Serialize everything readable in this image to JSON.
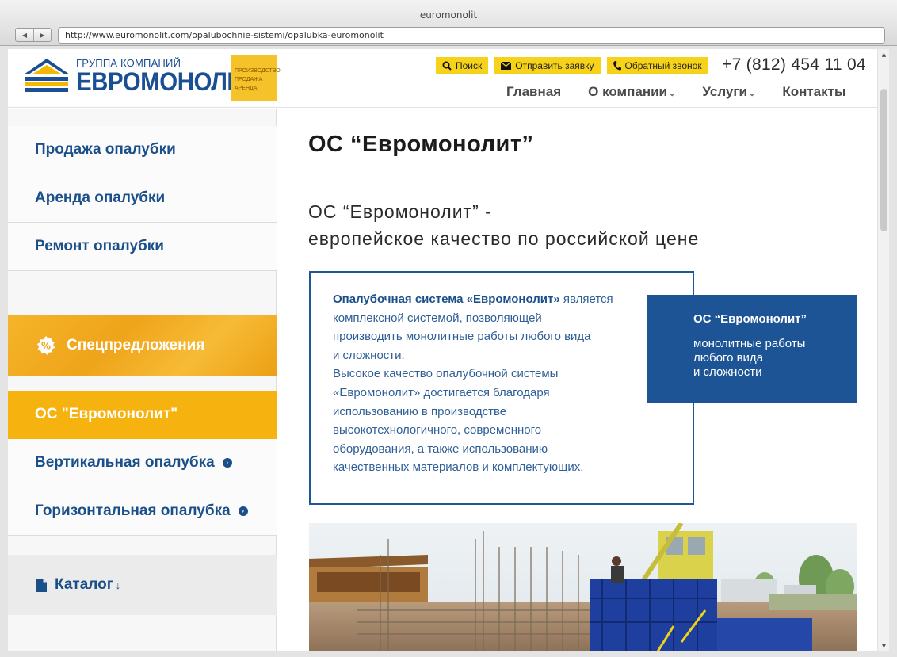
{
  "browser": {
    "window_title": "euromonolit",
    "url": "http://www.euromonolit.com/opalubochnie-sistemi/opalubka-euromonolit",
    "back_icon": "back-arrow-icon",
    "forward_icon": "forward-arrow-icon"
  },
  "header": {
    "logo_group": "ГРУППА КОМПАНИЙ",
    "logo_name": "ЕВРОМОНОЛИТ",
    "logo_badge_lines": [
      "ПРОИЗВОДСТВО",
      "ПРОДАЖА",
      "АРЕНДА"
    ],
    "actions": {
      "search": "Поиск",
      "send_request": "Отправить заявку",
      "callback": "Обратный звонок"
    },
    "phone": "+7 (812) 454 11 04",
    "nav": {
      "home": "Главная",
      "about": "О компании",
      "services": "Услуги",
      "contacts": "Контакты"
    },
    "accent_color": "#f7d21a"
  },
  "sidebar": {
    "sale": "Продажа опалубки",
    "rent": "Аренда опалубки",
    "repair": "Ремонт опалубки",
    "special": "Спецпредложения",
    "active": "ОС \"Евромонолит\"",
    "vertical": "Вертикальная опалубка",
    "horizontal": "Горизонтальная опалубка",
    "catalog": "Каталог",
    "catalog_arrow": "↓"
  },
  "main": {
    "title": "ОС “Евромонолит”",
    "subtitle_line1": "ОС “Евромонолит” -",
    "subtitle_line2": "европейское качество по российской цене",
    "info_bold": "Опалубочная система «Евромонолит»",
    "info_line1_rest": " является",
    "info_lines": [
      "комплексной системой, позволяющей",
      "производить монолитные работы любого вида",
      "и сложности.",
      "Высокое качество опалубочной системы",
      "«Евромонолит» достигается благодаря",
      "использованию в производстве",
      "высокотехнологичного, современного",
      "оборудования, а также использованию",
      "качественных материалов и комплектующих."
    ],
    "promo_title": "ОС “Евромонолит”",
    "promo_lines": [
      "монолитные работы",
      "любого вида",
      "и сложности"
    ],
    "brand_blue": "#1c5496"
  }
}
